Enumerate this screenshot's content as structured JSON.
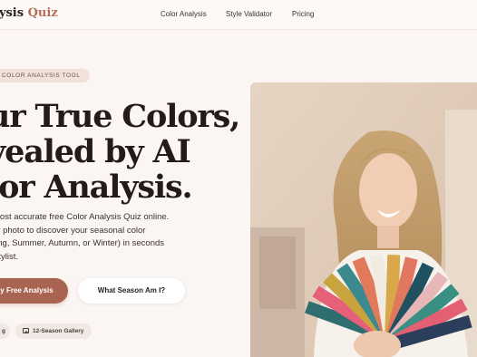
{
  "nav": {
    "brand_main": "lysis ",
    "brand_accent": "Quiz",
    "links": [
      "Color Analysis",
      "Style Validator",
      "Pricing"
    ]
  },
  "hero": {
    "tag": "COLOR ANALYSIS TOOL",
    "heading": [
      "ur True Colors,",
      "vealed by AI",
      "lor Analysis."
    ],
    "description": [
      "most accurate free Color Analysis Quiz online.",
      "ur photo to discover your seasonal color",
      "ring, Summer, Autumn, or Winter) in seconds",
      "Stylist."
    ],
    "primary_button": "y Free Analysis",
    "secondary_button": "What Season Am I?",
    "chips": [
      "g",
      "12-Season Gallery"
    ]
  },
  "colors": {
    "accent": "#a86451",
    "background": "#fbf6f3",
    "pill_bg": "#f1e1db"
  }
}
